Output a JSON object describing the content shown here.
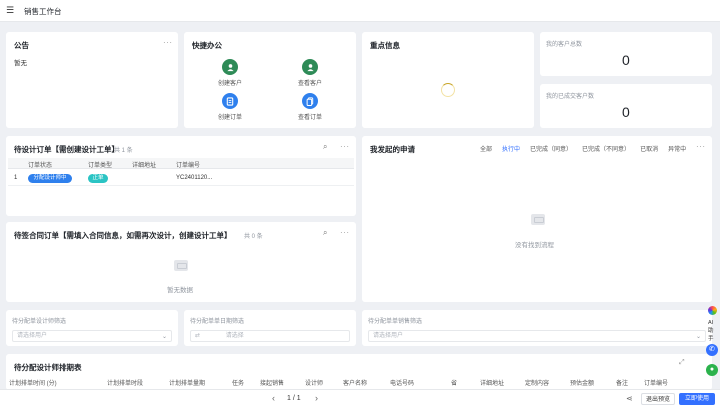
{
  "app": {
    "title": "销售工作台"
  },
  "notice": {
    "title": "公告",
    "content": "暂无"
  },
  "quick": {
    "title": "快捷办公",
    "items": [
      {
        "label": "创建客户",
        "icon": "user-plus-icon",
        "color": "#2e8b57"
      },
      {
        "label": "查看客户",
        "icon": "users-icon",
        "color": "#2e8b57"
      },
      {
        "label": "创建订单",
        "icon": "document-icon",
        "color": "#2f80ed"
      },
      {
        "label": "查看订单",
        "icon": "documents-icon",
        "color": "#2f80ed"
      }
    ]
  },
  "focus": {
    "title": "重点信息"
  },
  "stats": {
    "customers": {
      "label": "我的客户总数",
      "value": "0"
    },
    "deals": {
      "label": "我的已成交客户数",
      "value": "0"
    }
  },
  "design_orders": {
    "title": "待设计订单【需创建设计工单】",
    "count": "共 1 条",
    "columns": [
      "订单状态",
      "订单类型",
      "详细地址",
      "订单编号"
    ],
    "rows": [
      {
        "index": "1",
        "status": "分配设计师中",
        "type": "正单",
        "address": "",
        "order_no": "YC2401120..."
      }
    ],
    "status_color": "#2f80ed",
    "type_color": "#2bc4c4"
  },
  "my_requests": {
    "title": "我发起的申请",
    "tabs": [
      "全部",
      "执行中",
      "已完成（同意）",
      "已完成（不同意）",
      "已取消",
      "异常中"
    ],
    "active_tab": "执行中",
    "empty": "没有找到流程"
  },
  "contract_orders": {
    "title": "待签合同订单【需填入合同信息，如需再次设计，创建设计工单】",
    "count": "共 0 条",
    "empty": "暂无数据"
  },
  "filters": [
    {
      "label": "待分配单设计师筛选",
      "placeholder": "请选择用户"
    },
    {
      "label": "待分配单单日期筛选",
      "placeholder": "请选择"
    },
    {
      "label": "待分配单单销售筛选",
      "placeholder": "请选择用户"
    }
  ],
  "schedule": {
    "title": "待分配设计师排期表",
    "columns": [
      "计划排单时间 (分)",
      "计划排单时段",
      "计划排单量期",
      "任务",
      "接起销售",
      "设计师",
      "客户名称",
      "电话号码",
      "省",
      "详细地址",
      "定制内容",
      "预估金额",
      "备注",
      "订单编号"
    ]
  },
  "footer": {
    "pagination": "1 / 1",
    "prev": "‹",
    "next": "›",
    "exit_preview": "退出预览",
    "use_now": "立即使用"
  },
  "side": {
    "ai_label": "AI助手"
  },
  "colors": {
    "primary": "#3370ff",
    "green": "#2e8b57"
  }
}
